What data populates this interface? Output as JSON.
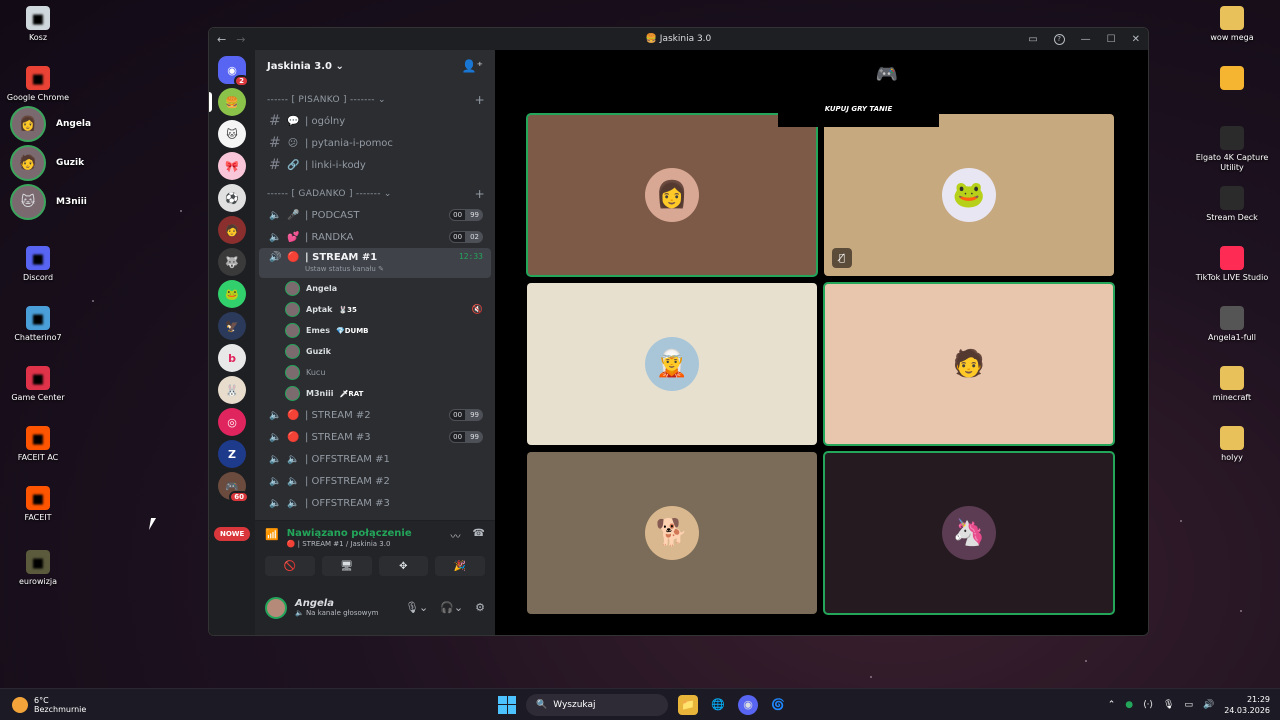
{
  "desktop_left": [
    {
      "label": "Kosz",
      "icon": "recycle-bin-icon",
      "color": "#cfd8dc"
    },
    {
      "label": "Google Chrome",
      "icon": "chrome-icon",
      "color": "#ea4335"
    },
    {
      "label": "Discord",
      "icon": "discord-icon",
      "color": "#5865f2"
    },
    {
      "label": "Chatterino7",
      "icon": "chatterino-icon",
      "color": "#4a9fd8"
    },
    {
      "label": "Game Center",
      "icon": "game-center-icon",
      "color": "#e0334a"
    },
    {
      "label": "FACEIT AC",
      "icon": "faceit-ac-icon",
      "color": "#ff5500"
    },
    {
      "label": "FACEIT",
      "icon": "faceit-icon",
      "color": "#ff5500"
    },
    {
      "label": "eurowizja",
      "icon": "folder-image-icon",
      "color": "#5b5a3c"
    }
  ],
  "pinned_contacts": [
    {
      "name": "Angela"
    },
    {
      "name": "Guzik"
    },
    {
      "name": "M3niii"
    }
  ],
  "desktop_right": [
    {
      "label": "wow mega",
      "icon": "folder-icon",
      "color": "#e8c15a"
    },
    {
      "label": "",
      "icon": "sun-app-icon",
      "color": "#f6b530"
    },
    {
      "label": "Elgato 4K Capture Utility",
      "icon": "elgato-icon",
      "color": "#2b2b2b"
    },
    {
      "label": "Stream Deck",
      "icon": "stream-deck-icon",
      "color": "#2b2b2b"
    },
    {
      "label": "TikTok LIVE Studio",
      "icon": "tiktok-icon",
      "color": "#fe2c55"
    },
    {
      "label": "Angela1-full",
      "icon": "blank-file-icon",
      "color": "#555"
    },
    {
      "label": "minecraft",
      "icon": "folder-icon",
      "color": "#e8c15a"
    },
    {
      "label": "holyy",
      "icon": "folder-icon",
      "color": "#e8c15a"
    }
  ],
  "window": {
    "title": "Jaskinia 3.0",
    "back": "←",
    "forward": "→"
  },
  "guild": {
    "name": "Jaskinia 3.0 ⌄"
  },
  "categories": {
    "pisanko": "------ [ PISANKO ] ------- ⌄",
    "gadanko": "------ [ GADANKO ] ------- ⌄"
  },
  "text_channels": [
    {
      "emoji": "💬",
      "name": "| ogólny"
    },
    {
      "emoji": "😕",
      "name": "| pytania-i-pomoc"
    },
    {
      "emoji": "🔗",
      "name": "| linki-i-kody"
    }
  ],
  "voice_channels_top": [
    {
      "emoji": "🎤",
      "name": "| PODCAST",
      "c1": "00",
      "c2": "99"
    },
    {
      "emoji": "💕",
      "name": "| RANDKA",
      "c1": "00",
      "c2": "02"
    }
  ],
  "active_channel": {
    "name": "| STREAM #1",
    "time": "12:33",
    "sub": "Ustaw status kanału ✎"
  },
  "voice_users": [
    {
      "name": "Angela",
      "tag": "",
      "muted": false,
      "dim": false
    },
    {
      "name": "Aptak",
      "tag": "🐰35",
      "muted": true,
      "dim": false
    },
    {
      "name": "Emes",
      "tag": "💎DUMB",
      "muted": false,
      "dim": false
    },
    {
      "name": "Guzik",
      "tag": "",
      "muted": false,
      "dim": false
    },
    {
      "name": "Kucu",
      "tag": "",
      "muted": false,
      "dim": true
    },
    {
      "name": "M3niii",
      "tag": "🗡RAT",
      "muted": false,
      "dim": false
    }
  ],
  "voice_channels_bottom": [
    {
      "emoji": "🔴",
      "name": "| STREAM #2",
      "c1": "00",
      "c2": "99"
    },
    {
      "emoji": "🔴",
      "name": "| STREAM #3",
      "c1": "00",
      "c2": "99"
    },
    {
      "emoji": "🔈",
      "name": "| OFFSTREAM #1",
      "c1": "",
      "c2": ""
    },
    {
      "emoji": "🔈",
      "name": "| OFFSTREAM #2",
      "c1": "",
      "c2": ""
    },
    {
      "emoji": "🔈",
      "name": "| OFFSTREAM #3",
      "c1": "",
      "c2": ""
    }
  ],
  "server_badges": {
    "nowe": "NOWE",
    "mentions": "2",
    "count": "60"
  },
  "voice_panel": {
    "status": "Nawiązano połączenie",
    "location": "🔴 | STREAM #1 / Jaskinia 3.0"
  },
  "user_panel": {
    "name": "Angela",
    "status": "🔈 Na kanale głosowym"
  },
  "ad": {
    "text": "KUPUJ GRY TANIE"
  },
  "tiles": [
    {
      "bg": "#7d5a47",
      "face_bg": "#d9a894",
      "face": "👩",
      "speaking": true,
      "muted": false
    },
    {
      "bg": "#c7a97f",
      "face_bg": "#e9e6f3",
      "face": "🐸",
      "speaking": false,
      "muted": true
    },
    {
      "bg": "#e7e0cf",
      "face_bg": "#a9c6d9",
      "face": "🧝",
      "speaking": false,
      "muted": false
    },
    {
      "bg": "#e7c6ad",
      "face_bg": "#e7c6ad",
      "face": "🧑",
      "speaking": true,
      "muted": false
    },
    {
      "bg": "#7a6c58",
      "face_bg": "#d9b890",
      "face": "🐕",
      "speaking": false,
      "muted": false
    },
    {
      "bg": "#251a20",
      "face_bg": "#5b3c52",
      "face": "🦄",
      "speaking": true,
      "muted": false
    }
  ],
  "taskbar": {
    "temp": "6°C",
    "weather": "Bezchmurnie",
    "search": "Wyszukaj",
    "time": "21:29",
    "date": "24.03.2026"
  }
}
